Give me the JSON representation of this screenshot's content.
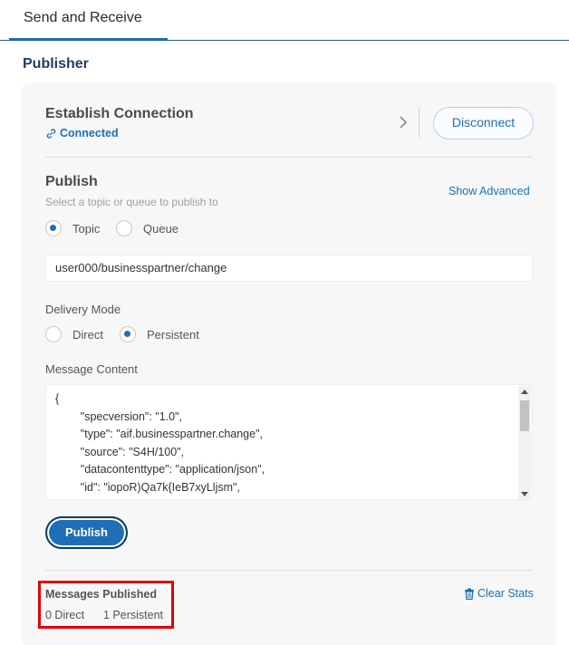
{
  "tabs": [
    {
      "label": "Send and Receive",
      "active": true
    }
  ],
  "section": {
    "title": "Publisher"
  },
  "connection": {
    "title": "Establish Connection",
    "status": "Connected",
    "disconnect_label": "Disconnect"
  },
  "publish": {
    "title": "Publish",
    "subtitle": "Select a topic or queue to publish to",
    "show_advanced": "Show Advanced",
    "dest_options": [
      {
        "label": "Topic",
        "selected": true
      },
      {
        "label": "Queue",
        "selected": false
      }
    ],
    "topic_value": "user000/businesspartner/change",
    "delivery_mode_label": "Delivery Mode",
    "delivery_options": [
      {
        "label": "Direct",
        "selected": false
      },
      {
        "label": "Persistent",
        "selected": true
      }
    ],
    "message_content_label": "Message Content",
    "message_content": "{\n        \"specversion\": \"1.0\",\n        \"type\": \"aif.businesspartner.change\",\n        \"source\": \"S4H/100\",\n        \"datacontenttype\": \"application/json\",\n        \"id\": \"iopoR)Qa7k{IeB7xyLljsm\",",
    "publish_button": "Publish"
  },
  "stats": {
    "title": "Messages Published",
    "direct": "0 Direct",
    "persistent": "1 Persistent",
    "clear_label": "Clear Stats"
  },
  "colors": {
    "accent": "#1e6fb5",
    "highlight_box": "#e00000"
  }
}
